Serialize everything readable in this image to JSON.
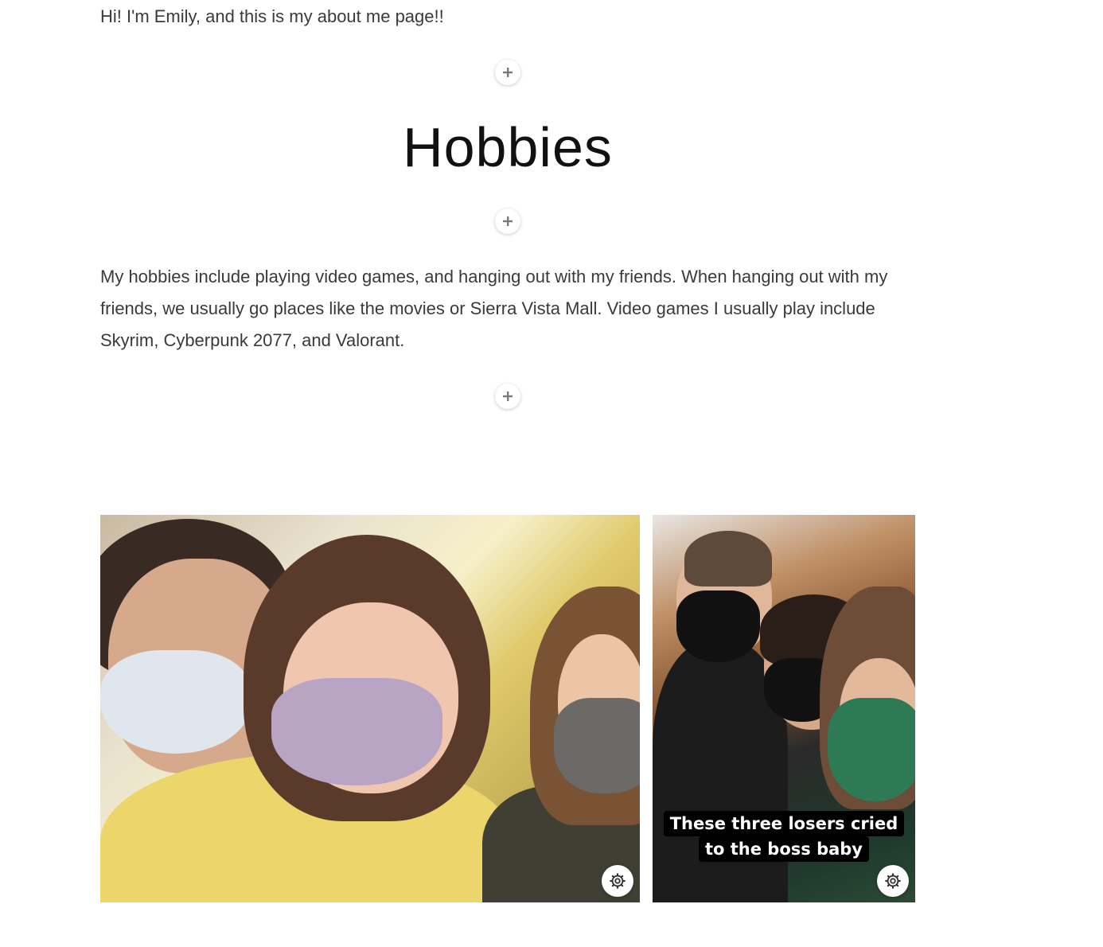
{
  "intro": {
    "text": "Hi! I'm Emily, and this is my about me page!!"
  },
  "hobbies": {
    "heading": "Hobbies",
    "body": "My hobbies include playing video games, and hanging out with my friends. When hanging out with my friends, we usually go places like the movies or Sierra Vista Mall. Video games I usually play include Skyrim, Cyberpunk 2077, and Valorant."
  },
  "gallery": {
    "photos": [
      {
        "caption_lines": []
      },
      {
        "caption_lines": [
          "These three losers cried",
          "to the boss baby"
        ]
      }
    ]
  },
  "icons": {
    "add": "plus-icon",
    "settings": "gear-icon"
  }
}
